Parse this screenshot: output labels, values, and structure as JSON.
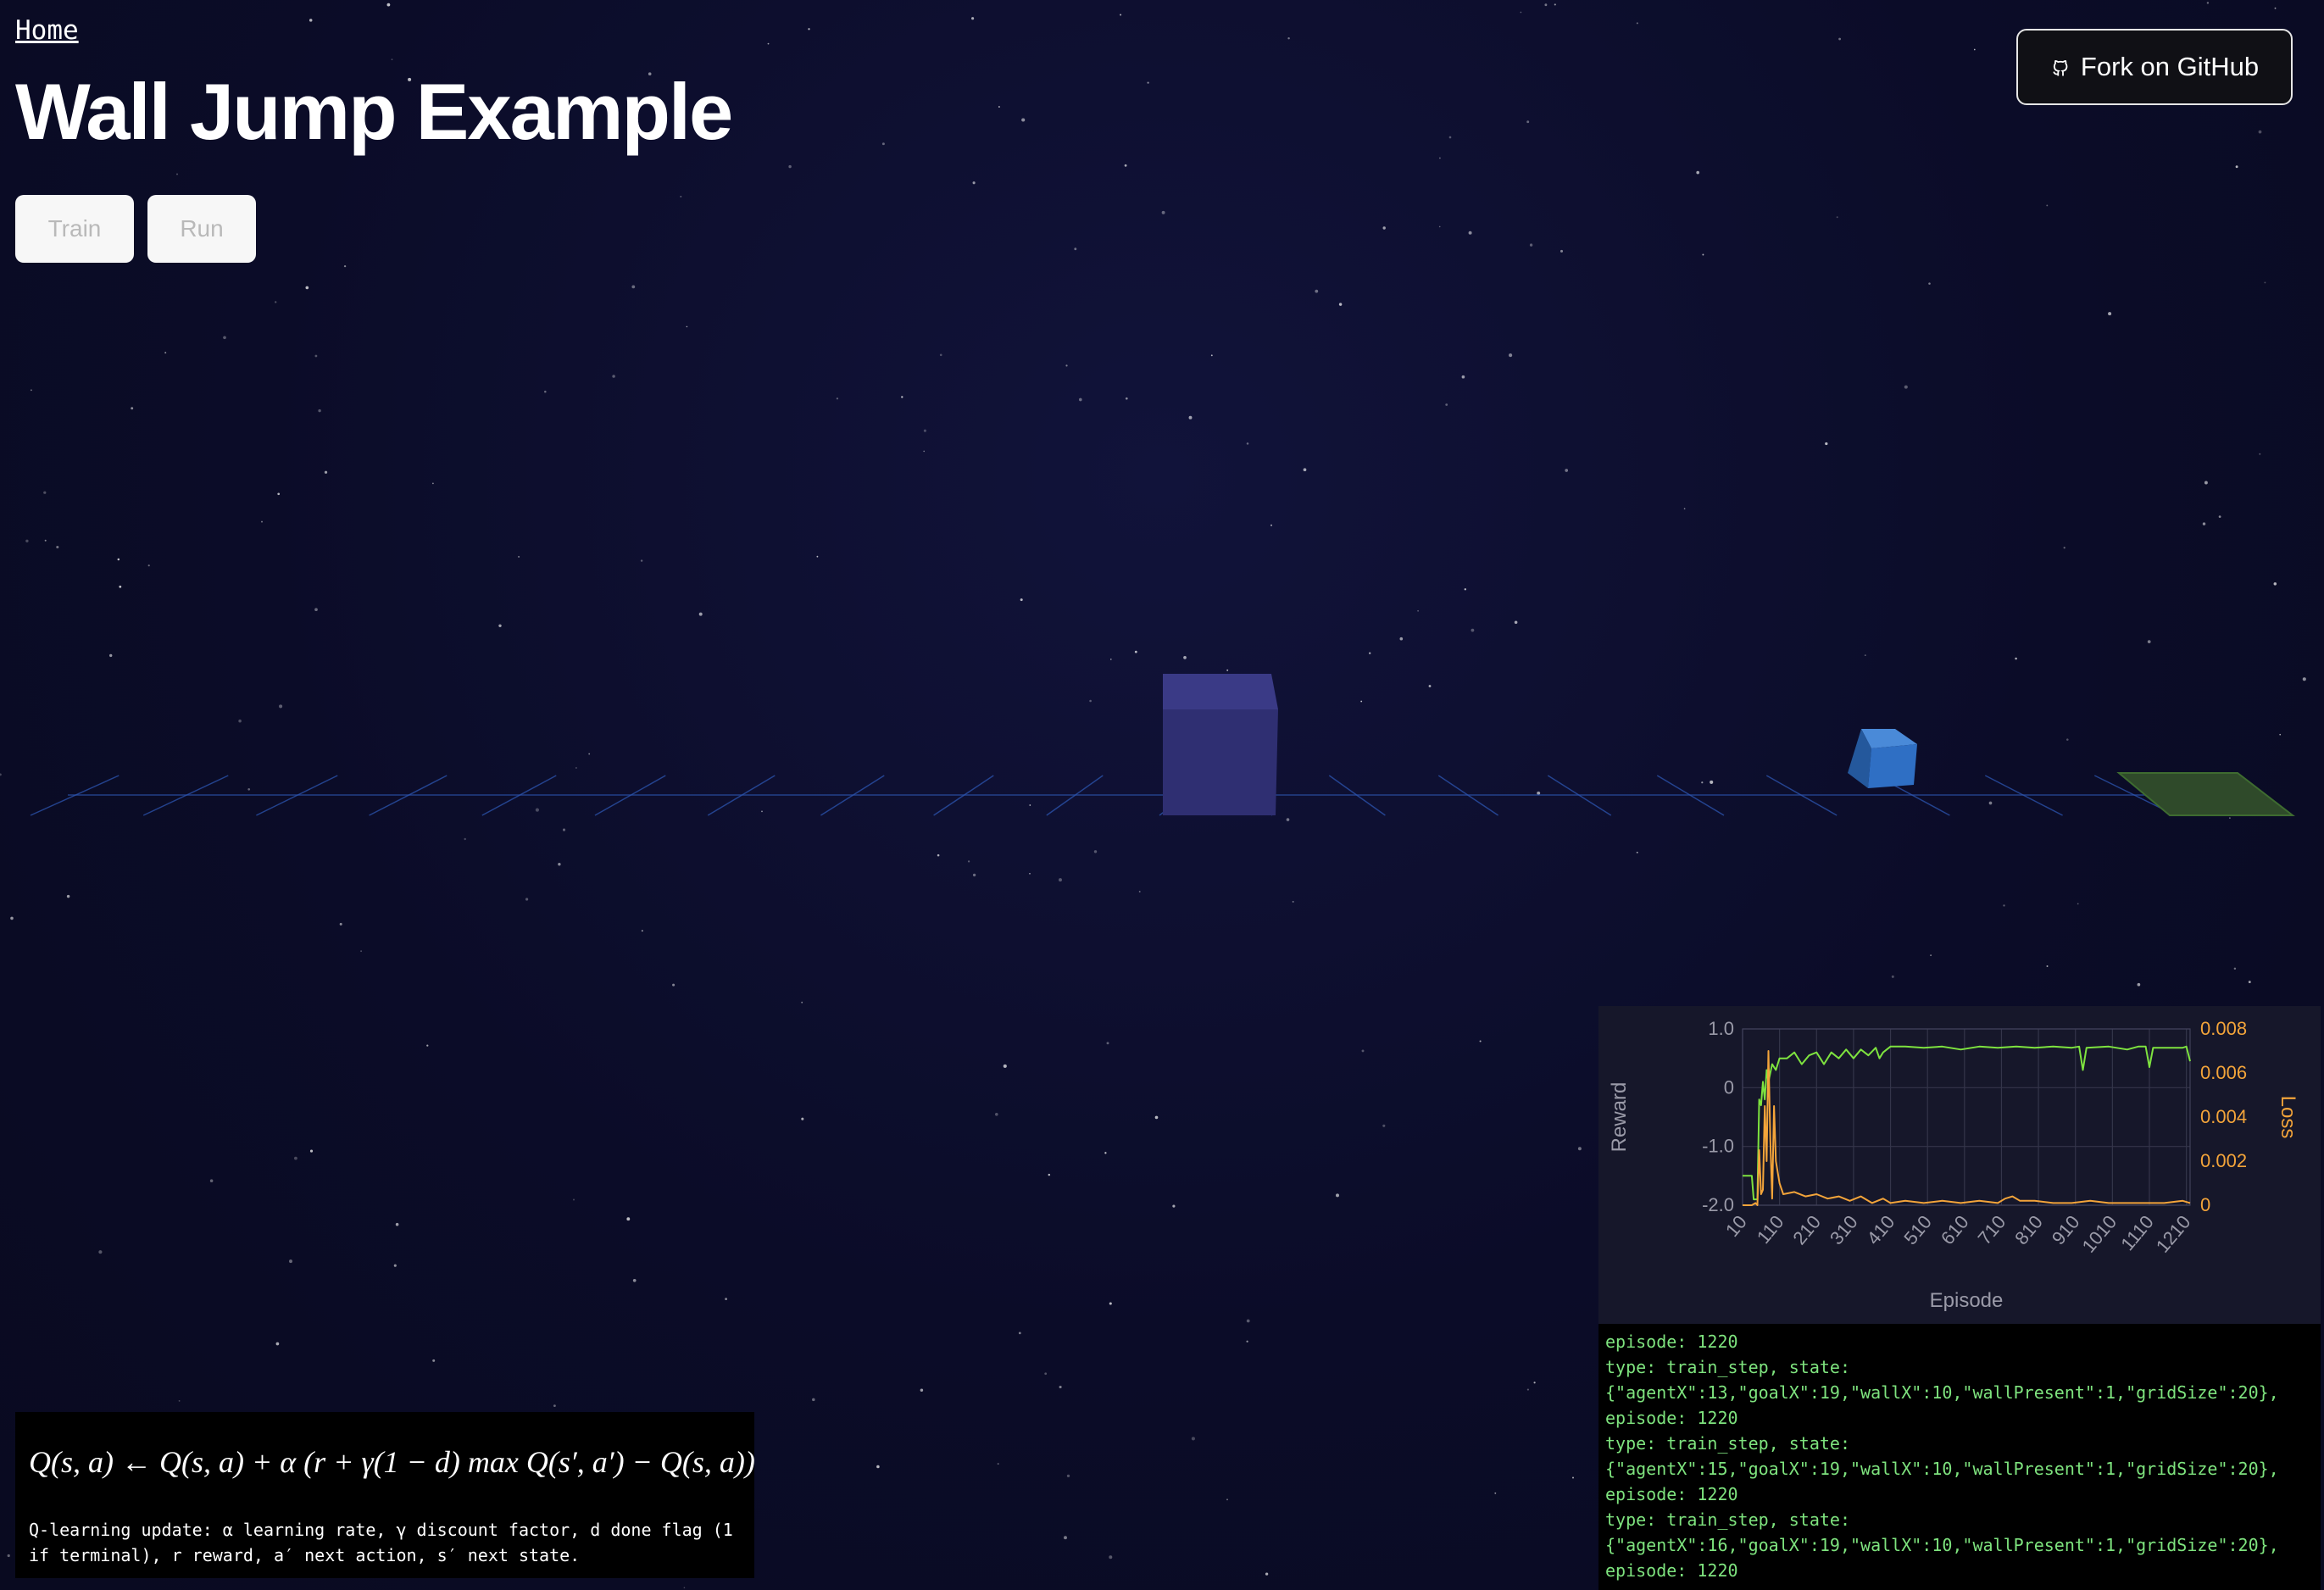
{
  "nav": {
    "home_label": "Home"
  },
  "header": {
    "title": "Wall Jump Example"
  },
  "controls": {
    "train_label": "Train",
    "run_label": "Run"
  },
  "github": {
    "label": "Fork on GitHub",
    "icon": "github-icon"
  },
  "scene": {
    "grid_size": 20,
    "wall_x": 10,
    "agent_x": 16,
    "goal_x": 19,
    "colors": {
      "grid": "#2c55b0",
      "wall": "#2f2f72",
      "agent": "#2f6fc4",
      "goal": "#2f4a2a"
    }
  },
  "chart_data": {
    "type": "line",
    "xlabel": "Episode",
    "y1label": "Reward",
    "y2label": "Loss",
    "y1ticks": [
      "1.0",
      "0",
      "-1.0",
      "-2.0"
    ],
    "y2ticks": [
      "0.008",
      "0.006",
      "0.004",
      "0.002",
      "0"
    ],
    "xticks": [
      "10",
      "110",
      "210",
      "310",
      "410",
      "510",
      "610",
      "710",
      "810",
      "910",
      "1010",
      "1110",
      "1210"
    ],
    "y1lim": [
      -2,
      1
    ],
    "y2lim": [
      0,
      0.008
    ],
    "xlim": [
      10,
      1220
    ],
    "grid": true,
    "series": [
      {
        "name": "Reward",
        "axis": "y1",
        "color": "#7ee33f",
        "points": [
          [
            10,
            -1.5
          ],
          [
            35,
            -1.5
          ],
          [
            40,
            -1.9
          ],
          [
            50,
            -1.9
          ],
          [
            55,
            -0.2
          ],
          [
            60,
            -0.3
          ],
          [
            65,
            0.1
          ],
          [
            70,
            -0.2
          ],
          [
            75,
            0.3
          ],
          [
            80,
            0.1
          ],
          [
            90,
            0.4
          ],
          [
            100,
            0.3
          ],
          [
            110,
            0.5
          ],
          [
            130,
            0.5
          ],
          [
            150,
            0.6
          ],
          [
            170,
            0.4
          ],
          [
            190,
            0.55
          ],
          [
            210,
            0.6
          ],
          [
            230,
            0.4
          ],
          [
            250,
            0.6
          ],
          [
            270,
            0.5
          ],
          [
            290,
            0.65
          ],
          [
            310,
            0.5
          ],
          [
            330,
            0.65
          ],
          [
            350,
            0.55
          ],
          [
            370,
            0.68
          ],
          [
            380,
            0.5
          ],
          [
            390,
            0.6
          ],
          [
            410,
            0.7
          ],
          [
            450,
            0.7
          ],
          [
            500,
            0.68
          ],
          [
            550,
            0.7
          ],
          [
            600,
            0.65
          ],
          [
            650,
            0.7
          ],
          [
            700,
            0.68
          ],
          [
            750,
            0.7
          ],
          [
            800,
            0.68
          ],
          [
            850,
            0.7
          ],
          [
            900,
            0.68
          ],
          [
            920,
            0.7
          ],
          [
            930,
            0.3
          ],
          [
            940,
            0.68
          ],
          [
            1000,
            0.7
          ],
          [
            1050,
            0.65
          ],
          [
            1080,
            0.7
          ],
          [
            1100,
            0.7
          ],
          [
            1110,
            0.35
          ],
          [
            1120,
            0.68
          ],
          [
            1200,
            0.68
          ],
          [
            1210,
            0.7
          ],
          [
            1220,
            0.45
          ]
        ]
      },
      {
        "name": "Loss",
        "axis": "y2",
        "color": "#f3a43a",
        "points": [
          [
            10,
            0
          ],
          [
            35,
            0
          ],
          [
            45,
            0.0001
          ],
          [
            50,
            0.0
          ],
          [
            55,
            0.0025
          ],
          [
            60,
            0.0005
          ],
          [
            65,
            0.0007
          ],
          [
            70,
            0.0045
          ],
          [
            75,
            0.002
          ],
          [
            80,
            0.007
          ],
          [
            85,
            0.003
          ],
          [
            90,
            0.0003
          ],
          [
            95,
            0.0045
          ],
          [
            100,
            0.002
          ],
          [
            110,
            0.001
          ],
          [
            120,
            0.0005
          ],
          [
            150,
            0.0006
          ],
          [
            180,
            0.0004
          ],
          [
            210,
            0.0005
          ],
          [
            240,
            0.0003
          ],
          [
            270,
            0.0004
          ],
          [
            300,
            0.0002
          ],
          [
            330,
            0.0004
          ],
          [
            360,
            0.0001
          ],
          [
            390,
            0.0003
          ],
          [
            410,
            0.0001
          ],
          [
            450,
            0.0002
          ],
          [
            500,
            0.0001
          ],
          [
            550,
            0.0002
          ],
          [
            600,
            0.0001
          ],
          [
            650,
            0.0002
          ],
          [
            700,
            0.0001
          ],
          [
            720,
            0.0003
          ],
          [
            740,
            0.0004
          ],
          [
            760,
            0.0002
          ],
          [
            800,
            0.0002
          ],
          [
            850,
            0.0001
          ],
          [
            900,
            0.0001
          ],
          [
            950,
            0.0002
          ],
          [
            1000,
            0.0001
          ],
          [
            1050,
            0.0001
          ],
          [
            1100,
            0.0001
          ],
          [
            1150,
            0.0001
          ],
          [
            1200,
            0.0002
          ],
          [
            1220,
            0.0001
          ]
        ]
      }
    ]
  },
  "log": {
    "lines": [
      "episode: 1220",
      "type: train_step, state:",
      "{\"agentX\":13,\"goalX\":19,\"wallX\":10,\"wallPresent\":1,\"gridSize\":20},",
      "episode: 1220",
      "type: train_step, state:",
      "{\"agentX\":15,\"goalX\":19,\"wallX\":10,\"wallPresent\":1,\"gridSize\":20},",
      "episode: 1220",
      "type: train_step, state:",
      "{\"agentX\":16,\"goalX\":19,\"wallX\":10,\"wallPresent\":1,\"gridSize\":20},",
      "episode: 1220"
    ]
  },
  "formula": {
    "equation": "Q(s, a) ← Q(s, a) + α (r + γ(1 − d) max Q(s′, a′) − Q(s, a))",
    "max_subscript": "a′",
    "note": "Q-learning update: α learning rate, γ discount factor, d done flag (1 if terminal), r reward, a′ next action, s′ next state."
  }
}
